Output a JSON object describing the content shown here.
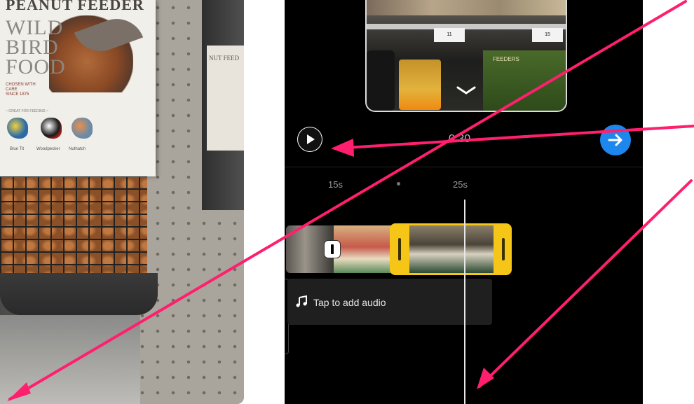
{
  "photo": {
    "product_title": "PEANUT FEEDER",
    "brand_line": "WILD\nBIRD\nFOOD",
    "tagline": "CHOSEN WITH CARE\nSINCE 1875",
    "attract": "~ GREAT FOR FEEDING ~",
    "birds": [
      "Blue Tit",
      "Woodpecker",
      "Nuthatch"
    ],
    "second_feeder_label": "NUT FEED"
  },
  "preview": {
    "price_tags": [
      "11",
      "15"
    ],
    "package_text": "FEEDERS"
  },
  "editor": {
    "time": "0:30",
    "timeline_ticks": [
      "15s",
      "25s"
    ],
    "audio_label": "Tap to add audio"
  },
  "colors": {
    "annotation_arrow": "#ff1f6e",
    "next_button": "#1d87ee",
    "selected_clip": "#f5c518",
    "editor_background": "#000000"
  },
  "icons": {
    "play": "play-icon",
    "next": "arrow-right-icon",
    "audio": "music-note-icon",
    "collapse": "chevron-down-icon"
  }
}
